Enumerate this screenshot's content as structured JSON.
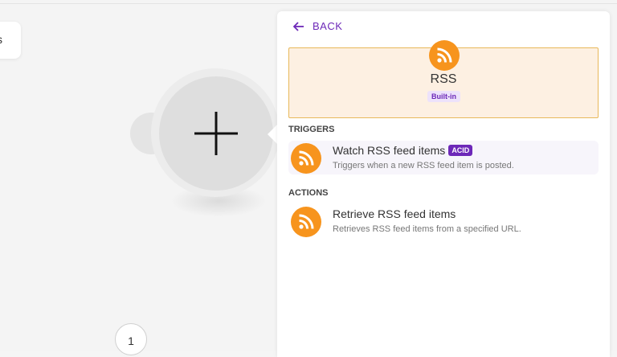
{
  "left_card": {
    "text": "s"
  },
  "node": {
    "counter": "1"
  },
  "panel": {
    "back_label": "BACK",
    "app": {
      "name": "RSS",
      "badge": "Built-in",
      "color": "#f7941d"
    },
    "triggers": {
      "title": "TRIGGERS",
      "items": [
        {
          "title": "Watch RSS feed items",
          "badge": "ACID",
          "description": "Triggers when a new RSS feed item is posted."
        }
      ]
    },
    "actions": {
      "title": "ACTIONS",
      "items": [
        {
          "title": "Retrieve RSS feed items",
          "description": "Retrieves RSS feed items from a specified URL."
        }
      ]
    }
  },
  "colors": {
    "accent": "#6d28b8",
    "rss": "#f7941d",
    "header_bg": "#fdf0e2",
    "header_border": "#e8b85a"
  }
}
